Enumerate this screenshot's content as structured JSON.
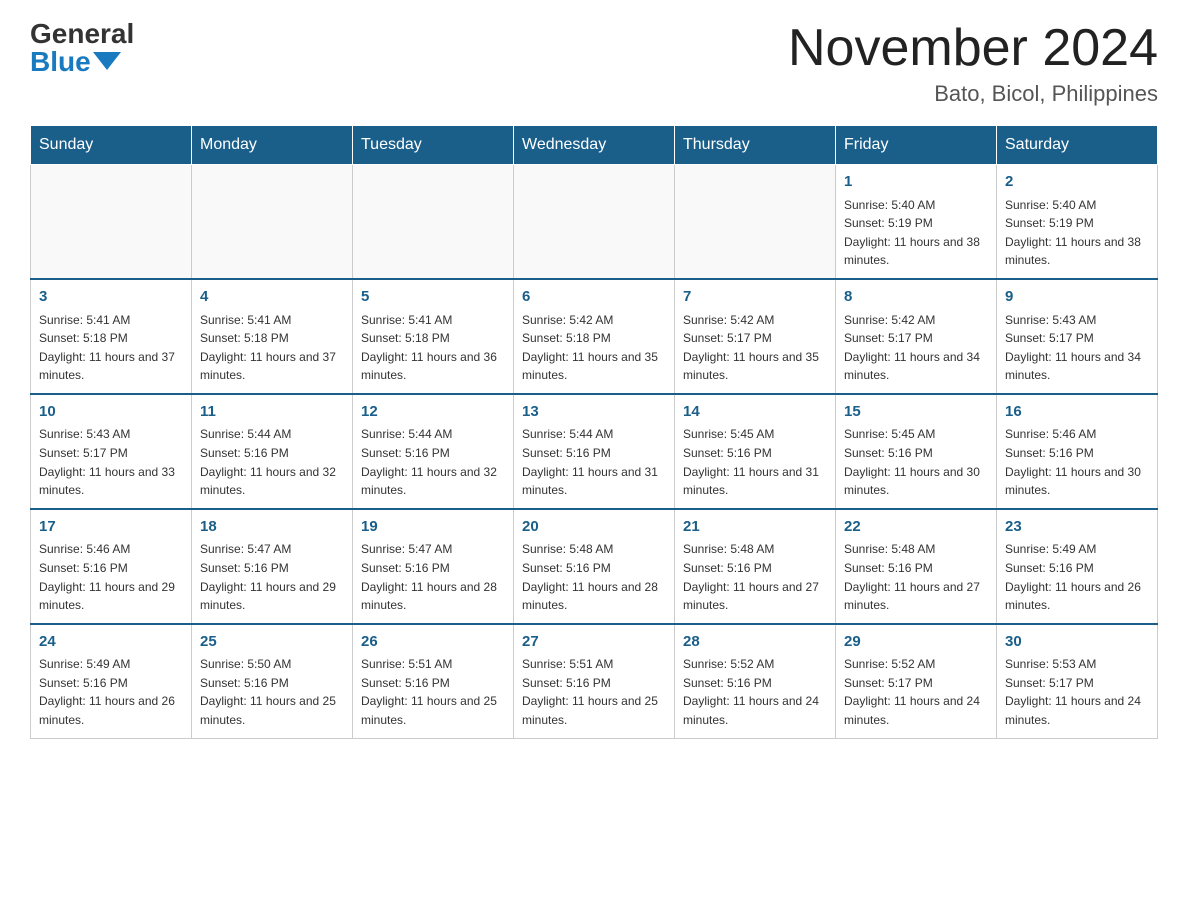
{
  "header": {
    "logo_general": "General",
    "logo_blue": "Blue",
    "month_title": "November 2024",
    "location": "Bato, Bicol, Philippines"
  },
  "days_of_week": [
    "Sunday",
    "Monday",
    "Tuesday",
    "Wednesday",
    "Thursday",
    "Friday",
    "Saturday"
  ],
  "weeks": [
    [
      {
        "day": "",
        "info": ""
      },
      {
        "day": "",
        "info": ""
      },
      {
        "day": "",
        "info": ""
      },
      {
        "day": "",
        "info": ""
      },
      {
        "day": "",
        "info": ""
      },
      {
        "day": "1",
        "info": "Sunrise: 5:40 AM\nSunset: 5:19 PM\nDaylight: 11 hours and 38 minutes."
      },
      {
        "day": "2",
        "info": "Sunrise: 5:40 AM\nSunset: 5:19 PM\nDaylight: 11 hours and 38 minutes."
      }
    ],
    [
      {
        "day": "3",
        "info": "Sunrise: 5:41 AM\nSunset: 5:18 PM\nDaylight: 11 hours and 37 minutes."
      },
      {
        "day": "4",
        "info": "Sunrise: 5:41 AM\nSunset: 5:18 PM\nDaylight: 11 hours and 37 minutes."
      },
      {
        "day": "5",
        "info": "Sunrise: 5:41 AM\nSunset: 5:18 PM\nDaylight: 11 hours and 36 minutes."
      },
      {
        "day": "6",
        "info": "Sunrise: 5:42 AM\nSunset: 5:18 PM\nDaylight: 11 hours and 35 minutes."
      },
      {
        "day": "7",
        "info": "Sunrise: 5:42 AM\nSunset: 5:17 PM\nDaylight: 11 hours and 35 minutes."
      },
      {
        "day": "8",
        "info": "Sunrise: 5:42 AM\nSunset: 5:17 PM\nDaylight: 11 hours and 34 minutes."
      },
      {
        "day": "9",
        "info": "Sunrise: 5:43 AM\nSunset: 5:17 PM\nDaylight: 11 hours and 34 minutes."
      }
    ],
    [
      {
        "day": "10",
        "info": "Sunrise: 5:43 AM\nSunset: 5:17 PM\nDaylight: 11 hours and 33 minutes."
      },
      {
        "day": "11",
        "info": "Sunrise: 5:44 AM\nSunset: 5:16 PM\nDaylight: 11 hours and 32 minutes."
      },
      {
        "day": "12",
        "info": "Sunrise: 5:44 AM\nSunset: 5:16 PM\nDaylight: 11 hours and 32 minutes."
      },
      {
        "day": "13",
        "info": "Sunrise: 5:44 AM\nSunset: 5:16 PM\nDaylight: 11 hours and 31 minutes."
      },
      {
        "day": "14",
        "info": "Sunrise: 5:45 AM\nSunset: 5:16 PM\nDaylight: 11 hours and 31 minutes."
      },
      {
        "day": "15",
        "info": "Sunrise: 5:45 AM\nSunset: 5:16 PM\nDaylight: 11 hours and 30 minutes."
      },
      {
        "day": "16",
        "info": "Sunrise: 5:46 AM\nSunset: 5:16 PM\nDaylight: 11 hours and 30 minutes."
      }
    ],
    [
      {
        "day": "17",
        "info": "Sunrise: 5:46 AM\nSunset: 5:16 PM\nDaylight: 11 hours and 29 minutes."
      },
      {
        "day": "18",
        "info": "Sunrise: 5:47 AM\nSunset: 5:16 PM\nDaylight: 11 hours and 29 minutes."
      },
      {
        "day": "19",
        "info": "Sunrise: 5:47 AM\nSunset: 5:16 PM\nDaylight: 11 hours and 28 minutes."
      },
      {
        "day": "20",
        "info": "Sunrise: 5:48 AM\nSunset: 5:16 PM\nDaylight: 11 hours and 28 minutes."
      },
      {
        "day": "21",
        "info": "Sunrise: 5:48 AM\nSunset: 5:16 PM\nDaylight: 11 hours and 27 minutes."
      },
      {
        "day": "22",
        "info": "Sunrise: 5:48 AM\nSunset: 5:16 PM\nDaylight: 11 hours and 27 minutes."
      },
      {
        "day": "23",
        "info": "Sunrise: 5:49 AM\nSunset: 5:16 PM\nDaylight: 11 hours and 26 minutes."
      }
    ],
    [
      {
        "day": "24",
        "info": "Sunrise: 5:49 AM\nSunset: 5:16 PM\nDaylight: 11 hours and 26 minutes."
      },
      {
        "day": "25",
        "info": "Sunrise: 5:50 AM\nSunset: 5:16 PM\nDaylight: 11 hours and 25 minutes."
      },
      {
        "day": "26",
        "info": "Sunrise: 5:51 AM\nSunset: 5:16 PM\nDaylight: 11 hours and 25 minutes."
      },
      {
        "day": "27",
        "info": "Sunrise: 5:51 AM\nSunset: 5:16 PM\nDaylight: 11 hours and 25 minutes."
      },
      {
        "day": "28",
        "info": "Sunrise: 5:52 AM\nSunset: 5:16 PM\nDaylight: 11 hours and 24 minutes."
      },
      {
        "day": "29",
        "info": "Sunrise: 5:52 AM\nSunset: 5:17 PM\nDaylight: 11 hours and 24 minutes."
      },
      {
        "day": "30",
        "info": "Sunrise: 5:53 AM\nSunset: 5:17 PM\nDaylight: 11 hours and 24 minutes."
      }
    ]
  ]
}
